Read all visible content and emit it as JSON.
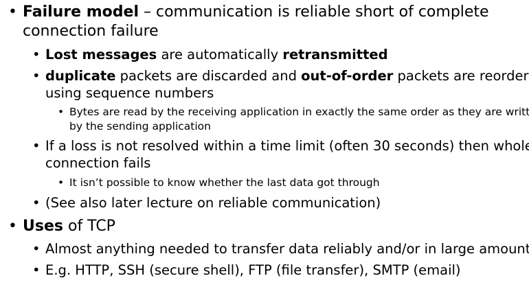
{
  "bullet_glyph": "•",
  "items": [
    {
      "level": 1,
      "lines": [
        [
          {
            "t": "Failure model",
            "b": true
          },
          {
            "t": " – communication is reliable short of complete",
            "b": false
          }
        ],
        [
          {
            "t": "connection failure",
            "b": false
          }
        ]
      ]
    },
    {
      "level": 2,
      "lines": [
        [
          {
            "t": "Lost messages",
            "b": true
          },
          {
            "t": " are automatically ",
            "b": false
          },
          {
            "t": "retransmitted",
            "b": true
          }
        ]
      ]
    },
    {
      "level": 2,
      "lines": [
        [
          {
            "t": "duplicate",
            "b": true
          },
          {
            "t": " packets are discarded and ",
            "b": false
          },
          {
            "t": "out-of-order",
            "b": true
          },
          {
            "t": " packets are reordered",
            "b": false
          }
        ],
        [
          {
            "t": "using sequence numbers",
            "b": false
          }
        ]
      ]
    },
    {
      "level": 3,
      "lines": [
        [
          {
            "t": "Bytes are read by the receiving application in exactly the same order as they are writt",
            "b": false
          }
        ],
        [
          {
            "t": "by the sending application",
            "b": false
          }
        ]
      ]
    },
    {
      "level": 2,
      "lines": [
        [
          {
            "t": "If a loss is not resolved within a time limit (often 30 seconds) then whole",
            "b": false
          }
        ],
        [
          {
            "t": "connection fails",
            "b": false
          }
        ]
      ]
    },
    {
      "level": 3,
      "lines": [
        [
          {
            "t": "It isn’t possible to know whether the last data got through",
            "b": false
          }
        ]
      ]
    },
    {
      "level": 2,
      "lines": [
        [
          {
            "t": "(See also later lecture on reliable communication)",
            "b": false
          }
        ]
      ]
    },
    {
      "level": 1,
      "lines": [
        [
          {
            "t": "Uses",
            "b": true
          },
          {
            "t": " of TCP",
            "b": false
          }
        ]
      ]
    },
    {
      "level": 2,
      "lines": [
        [
          {
            "t": "Almost anything needed to transfer data reliably and/or in large amounts",
            "b": false
          }
        ]
      ]
    },
    {
      "level": 2,
      "lines": [
        [
          {
            "t": "E.g. HTTP, SSH (secure shell), FTP (file transfer), SMTP (email)",
            "b": false
          }
        ]
      ]
    }
  ]
}
